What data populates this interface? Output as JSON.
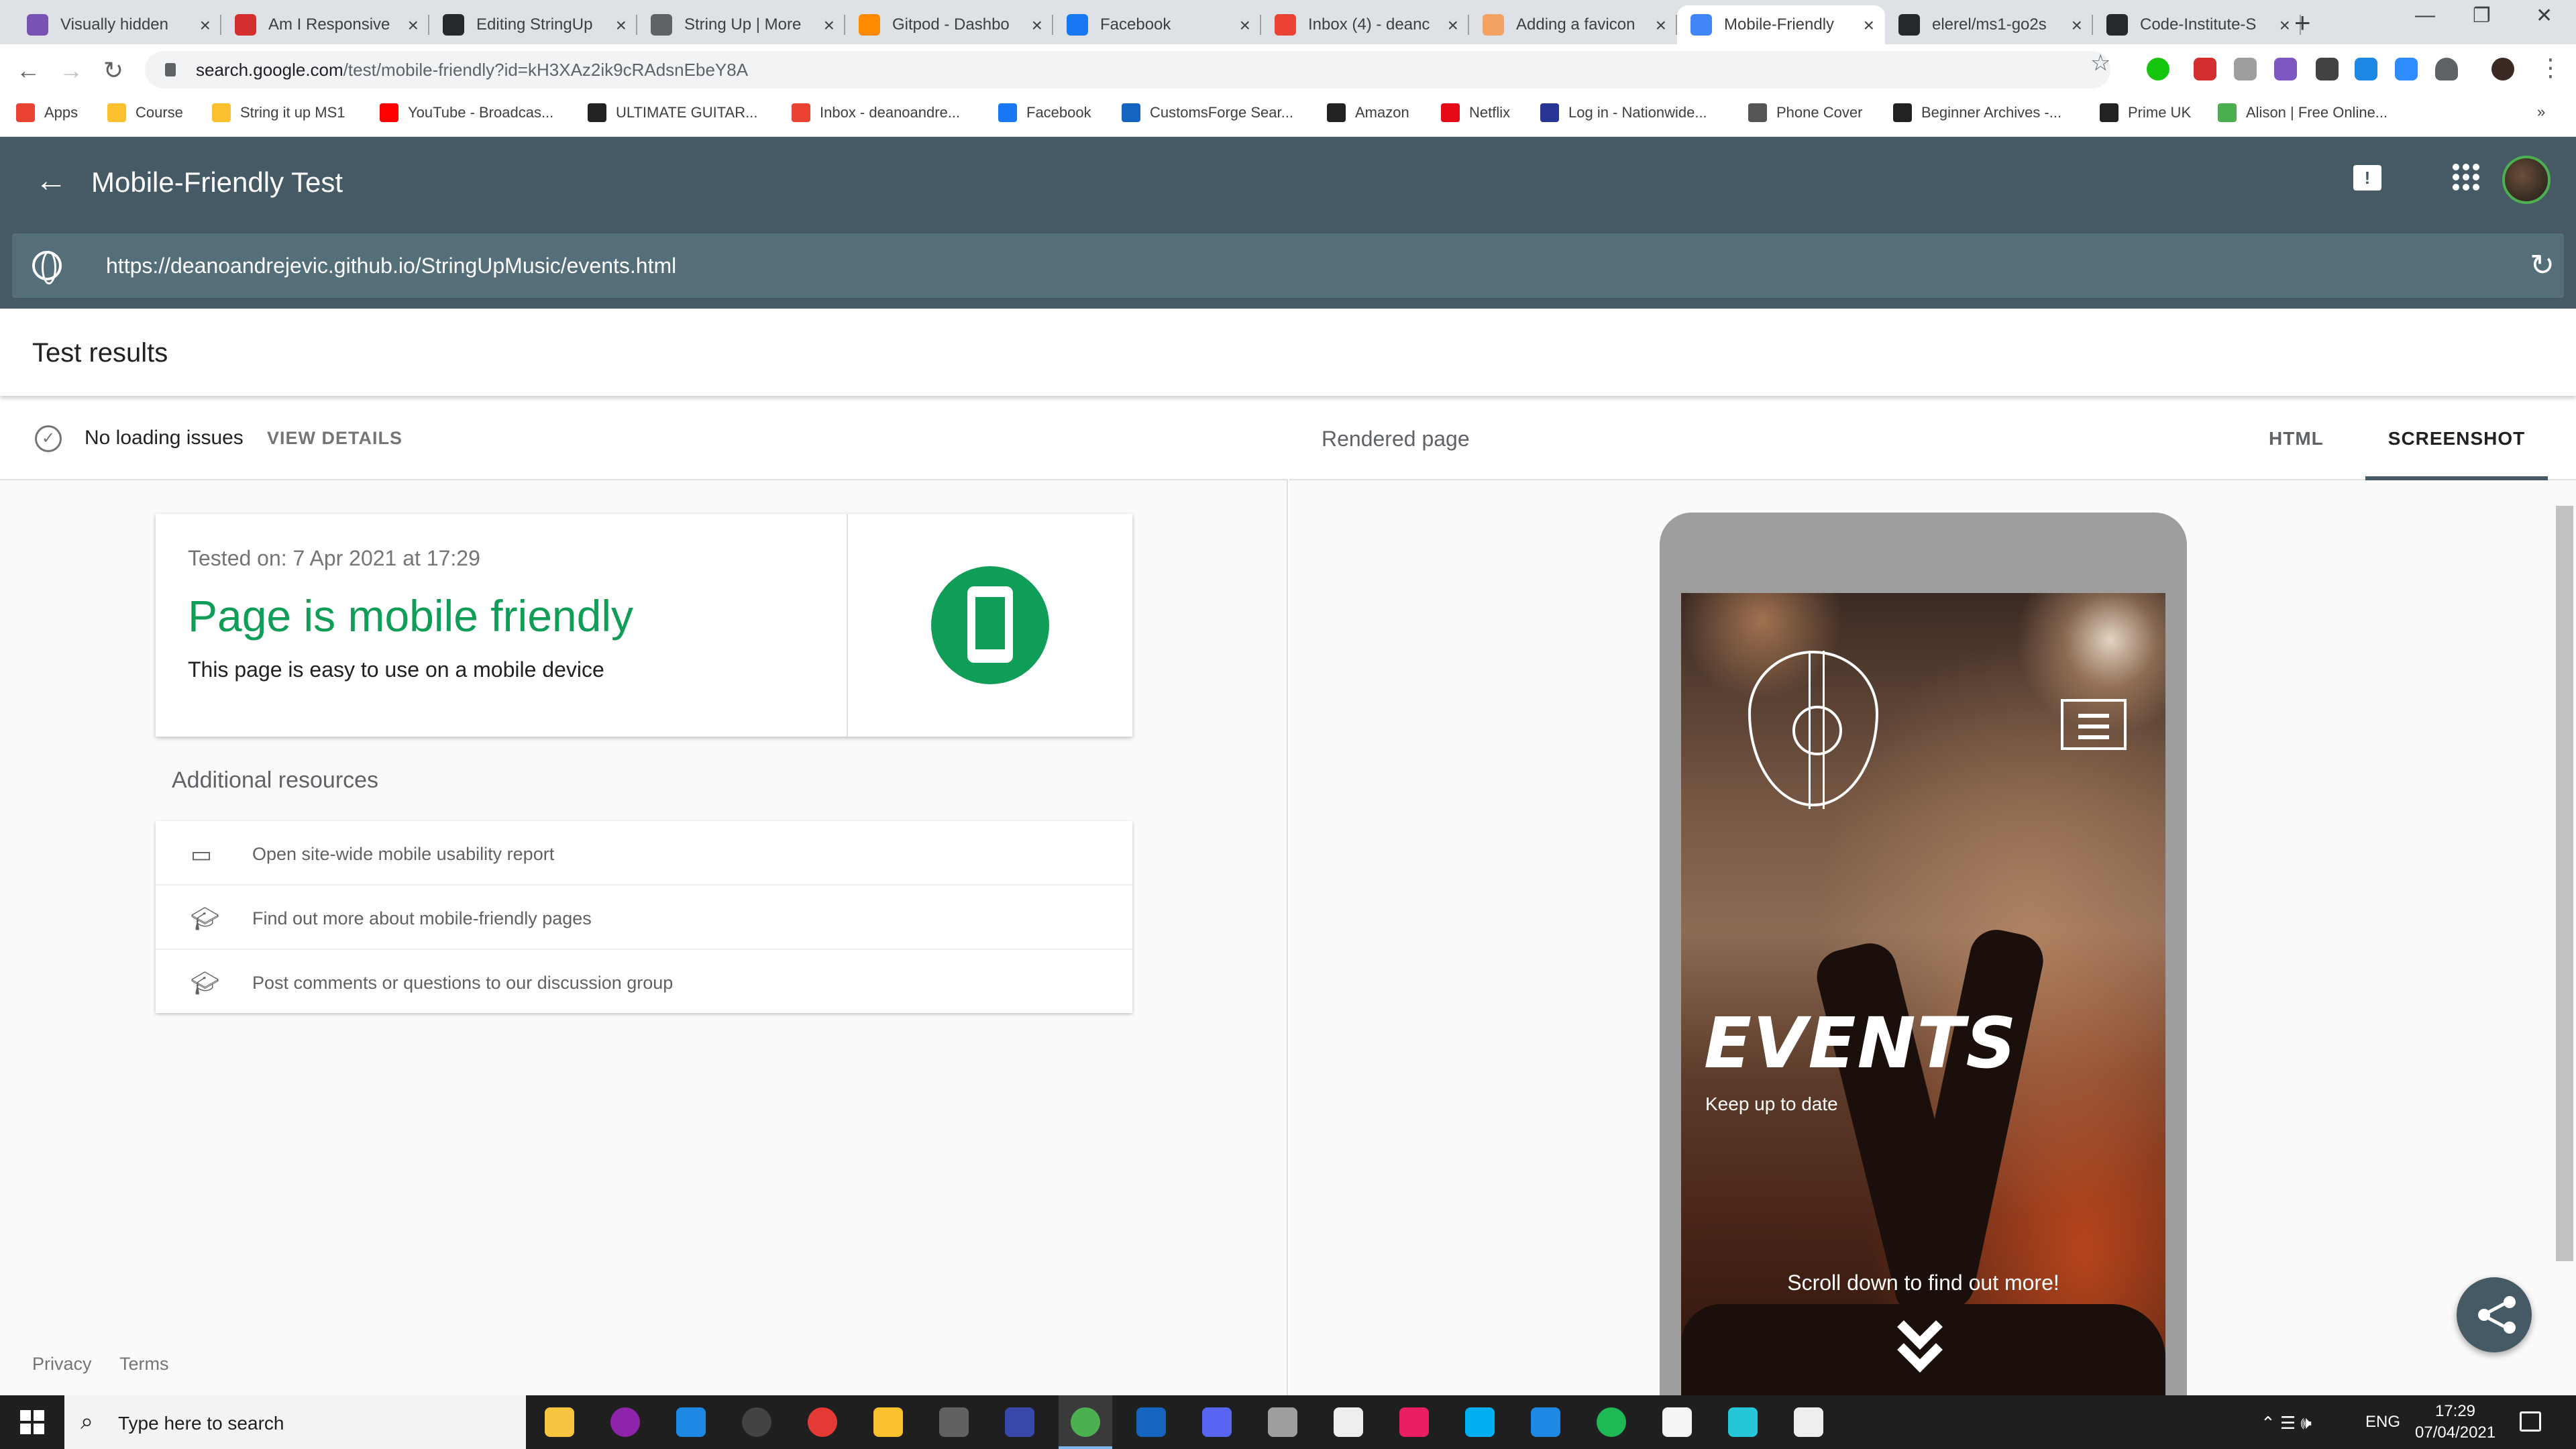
{
  "browser": {
    "tabs": [
      {
        "title": "Visually hidden",
        "favicon": "bootstrap-icon",
        "color": "#7952b3"
      },
      {
        "title": "Am I Responsive",
        "favicon": "amiresponsive-icon",
        "color": "#d32f2f"
      },
      {
        "title": "Editing StringUp",
        "favicon": "github-icon",
        "color": "#24292e"
      },
      {
        "title": "String Up | More",
        "favicon": "globe-icon",
        "color": "#5f6368"
      },
      {
        "title": "Gitpod - Dashbo",
        "favicon": "gitpod-icon",
        "color": "#ff8a00"
      },
      {
        "title": "Facebook",
        "favicon": "facebook-icon",
        "color": "#1877f2"
      },
      {
        "title": "Inbox (4) - deanc",
        "favicon": "gmail-icon",
        "color": "#ea4335"
      },
      {
        "title": "Adding a favicon",
        "favicon": "favicon-icon",
        "color": "#f4a261"
      },
      {
        "title": "Mobile-Friendly",
        "favicon": "google-search-console-icon",
        "color": "#4285f4"
      },
      {
        "title": "elerel/ms1-go2s",
        "favicon": "github-icon",
        "color": "#24292e"
      },
      {
        "title": "Code-Institute-S",
        "favicon": "github-icon",
        "color": "#24292e"
      }
    ],
    "address": {
      "host": "search.google.com",
      "path": "/test/mobile-friendly?id=kH3XAz2ik9cRAdsnEbeY8A"
    },
    "bookmarks": [
      {
        "label": "Apps",
        "color": "#ea4335"
      },
      {
        "label": "Course",
        "color": "#fbc02d"
      },
      {
        "label": "String it up MS1",
        "color": "#fbc02d"
      },
      {
        "label": "YouTube - Broadcas...",
        "color": "#ff0000"
      },
      {
        "label": "ULTIMATE GUITAR...",
        "color": "#222222"
      },
      {
        "label": "Inbox - deanoandre...",
        "color": "#ea4335"
      },
      {
        "label": "Facebook",
        "color": "#1877f2"
      },
      {
        "label": "CustomsForge Sear...",
        "color": "#1565c0"
      },
      {
        "label": "Amazon",
        "color": "#222222"
      },
      {
        "label": "Netflix",
        "color": "#e50914"
      },
      {
        "label": "Log in - Nationwide...",
        "color": "#283593"
      },
      {
        "label": "Phone Cover",
        "color": "#555555"
      },
      {
        "label": "Beginner Archives -...",
        "color": "#222222"
      },
      {
        "label": "Prime UK",
        "color": "#222222"
      },
      {
        "label": "Alison | Free Online...",
        "color": "#4caf50"
      }
    ]
  },
  "header": {
    "title": "Mobile-Friendly Test",
    "tested_url": "https://deanoandrejevic.github.io/StringUpMusic/events.html",
    "bg_color": "#455a64"
  },
  "results": {
    "title": "Test results",
    "status": "No loading issues",
    "view_details": "VIEW DETAILS",
    "tested_on": "Tested on: 7 Apr 2021 at 17:29",
    "verdict": "Page is mobile friendly",
    "verdict_sub": "This page is easy to use on a mobile device",
    "verdict_color": "#0f9d58"
  },
  "resources": {
    "title": "Additional resources",
    "items": [
      {
        "label": "Open site-wide mobile usability report",
        "icon": "report-icon"
      },
      {
        "label": "Find out more about mobile-friendly pages",
        "icon": "school-icon"
      },
      {
        "label": "Post comments or questions to our discussion group",
        "icon": "school-icon"
      }
    ]
  },
  "footer": {
    "privacy": "Privacy",
    "terms": "Terms"
  },
  "rendered": {
    "label": "Rendered page",
    "tabs": {
      "html": "HTML",
      "screenshot": "SCREENSHOT"
    },
    "selected_tab": "SCREENSHOT",
    "site": {
      "heading": "EVENTS",
      "subheading": "Keep up to date",
      "scroll_hint": "Scroll down to find out more!"
    }
  },
  "taskbar": {
    "search_placeholder": "Type here to search",
    "language": "ENG",
    "time": "17:29",
    "date": "07/04/2021"
  }
}
